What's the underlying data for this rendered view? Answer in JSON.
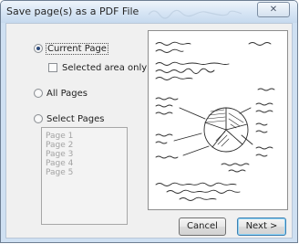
{
  "window": {
    "title": "Save page(s) as a PDF File",
    "close_glyph": "✕"
  },
  "options": {
    "current_page_label": "Current Page",
    "current_page_selected": true,
    "selected_area_label": "Selected area only",
    "selected_area_checked": false,
    "all_pages_label": "All Pages",
    "select_pages_label": "Select Pages"
  },
  "pages_list": {
    "items": [
      "Page 1",
      "Page 2",
      "Page 3",
      "Page 4",
      "Page 5"
    ]
  },
  "buttons": {
    "cancel_label": "Cancel",
    "next_label": "Next >"
  },
  "icons": {
    "close": "close-icon"
  },
  "colors": {
    "title_bar": "#d8e6f5",
    "dialog_bg": "#f0f0f0",
    "default_button_border": "#3c7fb1",
    "disabled_text": "#a3a3a3",
    "handwriting_ink": "#2a2a2a"
  }
}
